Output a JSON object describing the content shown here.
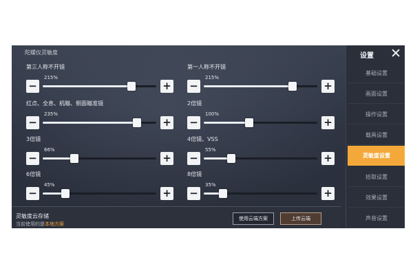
{
  "panel": {
    "title": "陀螺仪灵敏度"
  },
  "sliders": [
    {
      "label": "第三人称不开镜",
      "value": "215%",
      "fraction": 0.78
    },
    {
      "label": "第一人称不开镜",
      "value": "215%",
      "fraction": 0.78
    },
    {
      "label": "红点、全息、机瞄、侧面瞄准镜",
      "value": "235%",
      "fraction": 0.83
    },
    {
      "label": "2倍镜",
      "value": "100%",
      "fraction": 0.4
    },
    {
      "label": "3倍镜",
      "value": "66%",
      "fraction": 0.28
    },
    {
      "label": "4倍镜、VSS",
      "value": "55%",
      "fraction": 0.24
    },
    {
      "label": "6倍镜",
      "value": "45%",
      "fraction": 0.2
    },
    {
      "label": "8倍镜",
      "value": "35%",
      "fraction": 0.17
    }
  ],
  "buttons": {
    "minus": "−",
    "plus": "+"
  },
  "cloud": {
    "title": "灵敏度云存储",
    "sub_prefix": "当前使用的是",
    "sub_highlight": "本地方案",
    "use_label": "使用云端方案",
    "upload_label": "上传云端"
  },
  "sidebar": {
    "title": "设置",
    "items": [
      {
        "label": "基础设置"
      },
      {
        "label": "画面设置"
      },
      {
        "label": "操作设置"
      },
      {
        "label": "载具设置"
      },
      {
        "label": "灵敏度设置",
        "active": true
      },
      {
        "label": "拾取设置"
      },
      {
        "label": "效果设置"
      },
      {
        "label": "声音设置"
      }
    ]
  },
  "colors": {
    "accent": "#f4a83a",
    "highlight_text": "#f0a43a"
  }
}
